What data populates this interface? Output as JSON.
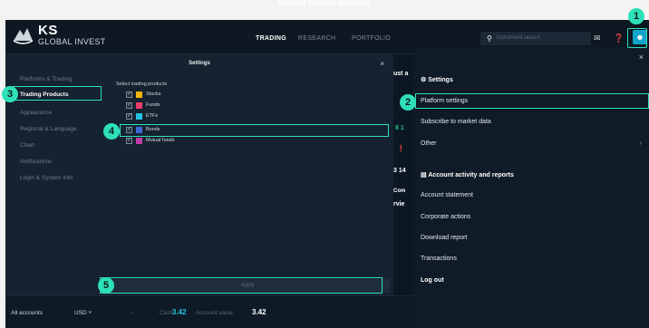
{
  "doc_heading": "Global Invest website",
  "brand": {
    "name": "KS",
    "sub": "GLOBAL INVEST"
  },
  "nav": {
    "trading": "TRADING",
    "research": "RESEARCH",
    "portfolio": "PORTFOLIO"
  },
  "search": {
    "placeholder": "Instrument search"
  },
  "settings": {
    "title": "Settings",
    "close": "×",
    "categories": [
      "Platforms & Trading",
      "Trading Products",
      "Appearance",
      "Regional & Language",
      "Chart",
      "Notifications",
      "Login & System Info"
    ],
    "products_heading": "Select trading products",
    "products": [
      {
        "label": "Stocks",
        "color": "#f5b50f"
      },
      {
        "label": "Funds",
        "color": "#ea3d6e"
      },
      {
        "label": "ETFs",
        "color": "#21c2df"
      },
      {
        "label": "Bonds",
        "color": "#3d6bd8"
      },
      {
        "label": "Mutual funds",
        "color": "#c43ca5"
      }
    ],
    "apply": "Apply"
  },
  "bottom_bar": {
    "accounts": "All accounts",
    "currency": "USD",
    "cash_label": "Cash",
    "cash_value": "3.42",
    "account_value_label": "Account value",
    "account_value": "3.42"
  },
  "user_menu": {
    "close": "×",
    "settings_header": "Settings",
    "platform_settings": "Platform settings",
    "subscribe": "Subscribe to market data",
    "other": "Other",
    "activity_header": "Account activity and reports",
    "account_statement": "Account statement",
    "corporate_actions": "Corporate actions",
    "download_report": "Download report",
    "transactions": "Transactions",
    "logout": "Log out"
  },
  "callouts": [
    "1",
    "2",
    "3",
    "4",
    "5"
  ],
  "accent": "#2ee0b8"
}
